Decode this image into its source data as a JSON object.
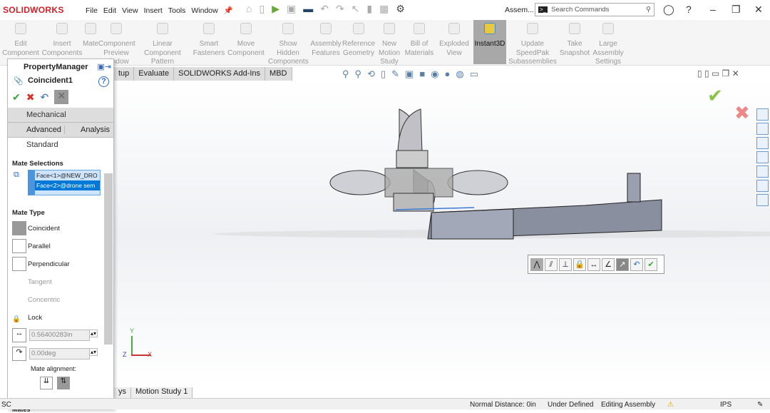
{
  "app": {
    "logo": "SOLIDWORKS",
    "menu": [
      "File",
      "Edit",
      "View",
      "Insert",
      "Tools",
      "Window"
    ],
    "doc_title": "Assem...",
    "search_placeholder": "Search Commands"
  },
  "ribbon": [
    {
      "label": "Edit Component"
    },
    {
      "label": "Insert Components"
    },
    {
      "label": "Mate"
    },
    {
      "label": "Component Preview Window"
    },
    {
      "label": "Linear Component Pattern"
    },
    {
      "label": "Smart Fasteners"
    },
    {
      "label": "Move Component"
    },
    {
      "label": "Show Hidden Components"
    },
    {
      "label": "Assembly Features"
    },
    {
      "label": "Reference Geometry"
    },
    {
      "label": "New Motion Study"
    },
    {
      "label": "Bill of Materials"
    },
    {
      "label": "Exploded View"
    },
    {
      "label": "Instant3D",
      "active": true
    },
    {
      "label": "Update SpeedPak Subassemblies"
    },
    {
      "label": "Take Snapshot"
    },
    {
      "label": "Large Assembly Settings"
    }
  ],
  "tabs": [
    "tup",
    "Evaluate",
    "SOLIDWORKS Add-Ins",
    "MBD"
  ],
  "pm": {
    "title": "PropertyManager",
    "feature": "Coincident1",
    "tabs": {
      "mechanical": "Mechanical",
      "advanced": "Advanced",
      "analysis": "Analysis",
      "standard": "Standard"
    },
    "mate_selections_label": "Mate Selections",
    "selections": [
      "Face<1>@NEW_DRO",
      "Face<2>@drone sem"
    ],
    "mate_type_label": "Mate Type",
    "mate_types": [
      {
        "label": "Coincident",
        "state": "selected"
      },
      {
        "label": "Parallel",
        "state": "enabled"
      },
      {
        "label": "Perpendicular",
        "state": "enabled"
      },
      {
        "label": "Tangent",
        "state": "disabled"
      },
      {
        "label": "Concentric",
        "state": "disabled"
      },
      {
        "label": "Lock",
        "state": "enabled"
      }
    ],
    "distance": "0.56400283in",
    "angle": "0.00deg",
    "alignment_label": "Mate alignment:",
    "bottom_label": "Mates"
  },
  "motion_tabs": [
    "ys",
    "Motion Study 1"
  ],
  "status": {
    "left": "SC",
    "normal_distance": "Normal Distance: 0in",
    "defined": "Under Defined",
    "mode": "Editing Assembly",
    "units": "IPS"
  },
  "colors": {
    "accent": "#0078d7",
    "ok": "#3aa53a",
    "cancel": "#d9342b"
  }
}
